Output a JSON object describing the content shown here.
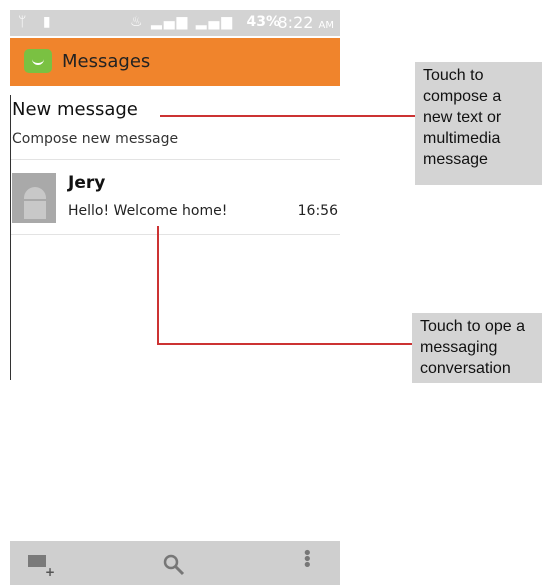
{
  "status_bar": {
    "battery": "43%",
    "time": "8:22",
    "time_suffix": "AM"
  },
  "title_bar": {
    "app_title": "Messages",
    "app_icon": "messages-smiley-icon"
  },
  "new_message": {
    "title": "New message",
    "subtitle": "Compose new message"
  },
  "conversations": [
    {
      "name": "Jery",
      "snippet": "Hello! Welcome home!",
      "time": "16:56",
      "avatar": "android-robot-icon"
    }
  ],
  "bottom_bar": {
    "icons": [
      "compose-icon",
      "search-icon",
      "menu-icon"
    ]
  },
  "callouts": {
    "compose": "Touch to compose a new text or multimedia message",
    "open": "Touch to ope a messaging conversation"
  },
  "colors": {
    "title_bar": "#f0842c",
    "callout_line": "#cc3333",
    "callout_bg": "#d4d4d4"
  }
}
